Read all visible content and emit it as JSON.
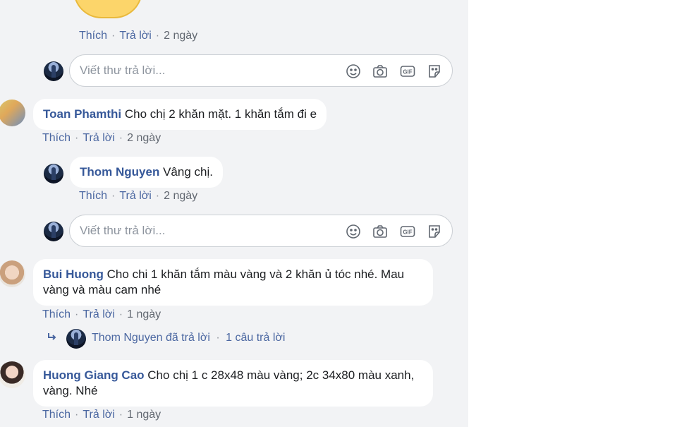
{
  "labels": {
    "like": "Thích",
    "reply": "Trả lời",
    "sep": "·"
  },
  "reply_placeholder": "Viết thư trả lời...",
  "top_comment": {
    "time": "2 ngày"
  },
  "comments": [
    {
      "name": "Toan Phamthi",
      "text": "Cho chị 2 khăn mặt. 1 khăn tắm đi e",
      "time": "2 ngày",
      "reply": {
        "name": "Thom Nguyen",
        "text": "Vâng chị.",
        "time": "2 ngày"
      }
    },
    {
      "name": "Bui Huong",
      "text": "Cho chi 1 khăn tắm màu vàng và 2 khăn ủ tóc nhé. Mau vàng và màu cam nhé",
      "time": "1 ngày",
      "reply_summary": {
        "replier": "Thom Nguyen đã trả lời",
        "count": "1 câu trả lời"
      }
    },
    {
      "name": "Huong Giang Cao",
      "text": "Cho chị 1 c 28x48 màu vàng; 2c 34x80 màu xanh, vàng. Nhé",
      "time": "1 ngày"
    }
  ],
  "icons": [
    "emoji-icon",
    "camera-icon",
    "gif-icon",
    "sticker-icon",
    "reply-arrow-icon"
  ],
  "colors": {
    "link": "#4b67a1",
    "name": "#365899",
    "panel_bg": "#f2f3f5",
    "bubble_bg": "#ffffff"
  }
}
